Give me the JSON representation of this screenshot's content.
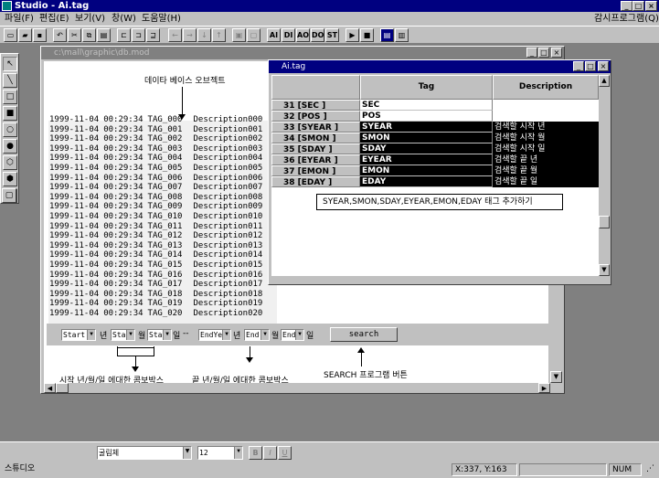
{
  "app": {
    "title": "Studio - Ai.tag"
  },
  "menu": {
    "items": [
      "파일(F)",
      "편집(E)",
      "보기(V)",
      "창(W)",
      "도움말(H)"
    ],
    "right": "감시프로그램(Q)"
  },
  "toolbar": {
    "text_buttons": [
      "AI",
      "DI",
      "AO",
      "DO",
      "ST"
    ]
  },
  "child": {
    "title": "c:\\mall\\graphic\\db.mod",
    "rows": [
      {
        "d": "1999-11-04",
        "t": "00:29:34",
        "tag": "TAG_000",
        "desc": "Description000"
      },
      {
        "d": "1999-11-04",
        "t": "00:29:34",
        "tag": "TAG_001",
        "desc": "Description001"
      },
      {
        "d": "1999-11-04",
        "t": "00:29:34",
        "tag": "TAG_002",
        "desc": "Description002"
      },
      {
        "d": "1999-11-04",
        "t": "00:29:34",
        "tag": "TAG_003",
        "desc": "Description003"
      },
      {
        "d": "1999-11-04",
        "t": "00:29:34",
        "tag": "TAG_004",
        "desc": "Description004"
      },
      {
        "d": "1999-11-04",
        "t": "00:29:34",
        "tag": "TAG_005",
        "desc": "Description005"
      },
      {
        "d": "1999-11-04",
        "t": "00:29:34",
        "tag": "TAG_006",
        "desc": "Description006"
      },
      {
        "d": "1999-11-04",
        "t": "00:29:34",
        "tag": "TAG_007",
        "desc": "Description007"
      },
      {
        "d": "1999-11-04",
        "t": "00:29:34",
        "tag": "TAG_008",
        "desc": "Description008"
      },
      {
        "d": "1999-11-04",
        "t": "00:29:34",
        "tag": "TAG_009",
        "desc": "Description009"
      },
      {
        "d": "1999-11-04",
        "t": "00:29:34",
        "tag": "TAG_010",
        "desc": "Description010"
      },
      {
        "d": "1999-11-04",
        "t": "00:29:34",
        "tag": "TAG_011",
        "desc": "Description011"
      },
      {
        "d": "1999-11-04",
        "t": "00:29:34",
        "tag": "TAG_012",
        "desc": "Description012"
      },
      {
        "d": "1999-11-04",
        "t": "00:29:34",
        "tag": "TAG_013",
        "desc": "Description013"
      },
      {
        "d": "1999-11-04",
        "t": "00:29:34",
        "tag": "TAG_014",
        "desc": "Description014"
      },
      {
        "d": "1999-11-04",
        "t": "00:29:34",
        "tag": "TAG_015",
        "desc": "Description015"
      },
      {
        "d": "1999-11-04",
        "t": "00:29:34",
        "tag": "TAG_016",
        "desc": "Description016"
      },
      {
        "d": "1999-11-04",
        "t": "00:29:34",
        "tag": "TAG_017",
        "desc": "Description017"
      },
      {
        "d": "1999-11-04",
        "t": "00:29:34",
        "tag": "TAG_018",
        "desc": "Description018"
      },
      {
        "d": "1999-11-04",
        "t": "00:29:34",
        "tag": "TAG_019",
        "desc": "Description019"
      },
      {
        "d": "1999-11-04",
        "t": "00:29:34",
        "tag": "TAG_020",
        "desc": "Description020"
      }
    ],
    "controls": {
      "start": "Start",
      "year": "년",
      "sta_month": "Sta",
      "month": "월",
      "sta_day": "Sta",
      "day": "일",
      "dash": "--",
      "endye": "EndYe",
      "end_month": "End",
      "end_day": "End",
      "search": "search"
    }
  },
  "annotations": {
    "db": "데이타 베이스 오브젝트",
    "start_combo": "시작 년/월/일 에대한 콤보박스",
    "end_combo": "끝 년/월/일 에대한 콤보박스",
    "search_btn": "SEARCH 프로그램 버튼"
  },
  "aitag": {
    "title": "Ai.tag",
    "col_tag": "Tag",
    "col_desc": "Description",
    "rows": [
      {
        "h": "31 [SEC    ]",
        "tag": "SEC",
        "desc": "",
        "dark": false
      },
      {
        "h": "32 [POS    ]",
        "tag": "POS",
        "desc": "",
        "dark": false
      },
      {
        "h": "33 [SYEAR  ]",
        "tag": "SYEAR",
        "desc": "검색할 시작 년",
        "dark": true
      },
      {
        "h": "34 [SMON   ]",
        "tag": "SMON",
        "desc": "검색할 시작 월",
        "dark": true
      },
      {
        "h": "35 [SDAY   ]",
        "tag": "SDAY",
        "desc": "검색할 시작 일",
        "dark": true
      },
      {
        "h": "36 [EYEAR  ]",
        "tag": "EYEAR",
        "desc": "검색할 끝 년",
        "dark": true
      },
      {
        "h": "37 [EMON   ]",
        "tag": "EMON",
        "desc": "검색할 끝 월",
        "dark": true
      },
      {
        "h": "38 [EDAY   ]",
        "tag": "EDAY",
        "desc": "검색할 끝 일",
        "dark": true
      }
    ],
    "callout": "SYEAR,SMON,SDAY,EYEAR,EMON,EDAY  태그 추가하기"
  },
  "fontbar": {
    "font": "굴림체",
    "size": "12",
    "bold": "B",
    "italic": "I",
    "underline": "U"
  },
  "status": {
    "left": "스튜디오",
    "coords": "X:337, Y:163",
    "num": "NUM"
  }
}
